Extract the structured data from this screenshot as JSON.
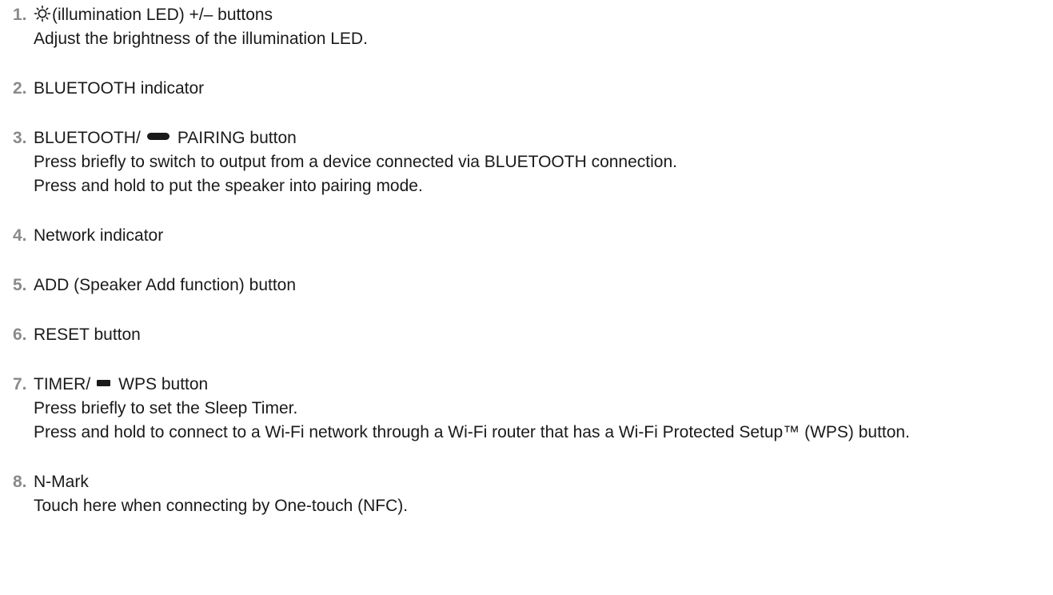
{
  "items": [
    {
      "num": "1.",
      "icon": "sun-icon",
      "title": "(illumination LED) +/– buttons",
      "desc": [
        "Adjust the brightness of the illumination LED."
      ]
    },
    {
      "num": "2.",
      "title": "BLUETOOTH indicator",
      "desc": []
    },
    {
      "num": "3.",
      "title_pre": "BLUETOOTH/",
      "icon": "pill-icon",
      "title_post": "PAIRING button",
      "desc": [
        "Press briefly to switch to output from a device connected via BLUETOOTH connection.",
        "Press and hold to put the speaker into pairing mode."
      ]
    },
    {
      "num": "4.",
      "title": "Network indicator",
      "desc": []
    },
    {
      "num": "5.",
      "title": "ADD (Speaker Add function) button",
      "desc": []
    },
    {
      "num": "6.",
      "title": "RESET button",
      "desc": []
    },
    {
      "num": "7.",
      "title_pre": "TIMER/",
      "icon": "rect-icon",
      "title_post": "WPS button",
      "desc": [
        "Press briefly to set the Sleep Timer.",
        "Press and hold to connect to a Wi-Fi network through a Wi-Fi router that has a Wi-Fi Protected Setup™ (WPS) button."
      ]
    },
    {
      "num": "8.",
      "title": "N-Mark",
      "desc": [
        "Touch here when connecting by One-touch (NFC)."
      ]
    }
  ]
}
